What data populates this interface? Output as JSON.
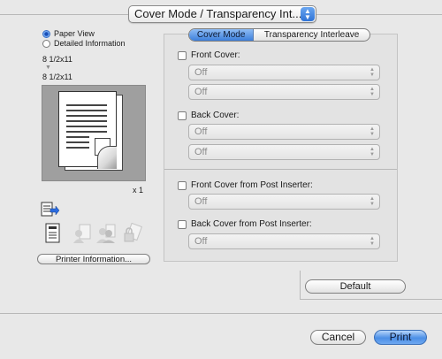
{
  "header": {
    "popup_value": "Cover Mode / Transparency Int..."
  },
  "left_panel": {
    "view_options": [
      {
        "label": "Paper View",
        "selected": true
      },
      {
        "label": "Detailed Information",
        "selected": false
      }
    ],
    "original_size": "8 1/2x11",
    "output_size": "8 1/2x11",
    "copies_label": "x 1",
    "printer_info_label": "Printer Information..."
  },
  "tabs": [
    {
      "label": "Cover Mode",
      "active": true
    },
    {
      "label": "Transparency Interleave",
      "active": false
    }
  ],
  "cover_mode": {
    "front_cover": {
      "label": "Front Cover:",
      "checked": false,
      "select1": "Off",
      "select2": "Off"
    },
    "back_cover": {
      "label": "Back Cover:",
      "checked": false,
      "select1": "Off",
      "select2": "Off"
    },
    "front_cover_post": {
      "label": "Front Cover from Post Inserter:",
      "checked": false,
      "select": "Off"
    },
    "back_cover_post": {
      "label": "Back Cover from Post Inserter:",
      "checked": false,
      "select": "Off"
    }
  },
  "buttons": {
    "default": "Default",
    "cancel": "Cancel",
    "print": "Print"
  },
  "colors": {
    "accent": "#3c7fdb",
    "background": "#e8e8e8"
  }
}
